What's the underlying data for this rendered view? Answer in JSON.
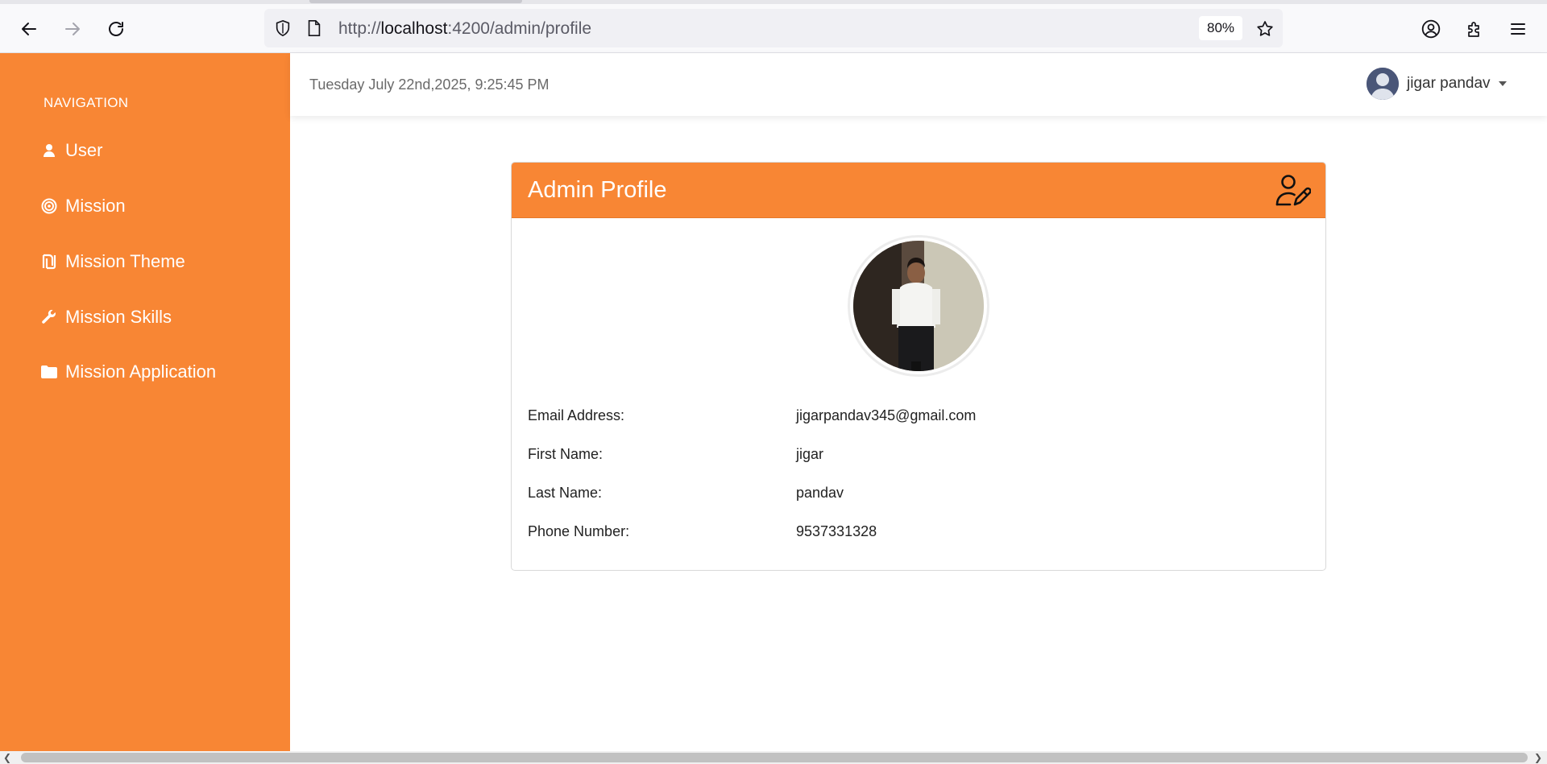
{
  "browser": {
    "url_prefix": "http://",
    "url_host": "localhost",
    "url_rest": ":4200/admin/profile",
    "zoom": "80%"
  },
  "sidebar": {
    "heading": "NAVIGATION",
    "items": [
      {
        "label": "User",
        "icon": "user-icon"
      },
      {
        "label": "Mission",
        "icon": "target-icon"
      },
      {
        "label": "Mission Theme",
        "icon": "theme-icon"
      },
      {
        "label": "Mission Skills",
        "icon": "wrench-icon"
      },
      {
        "label": "Mission Application",
        "icon": "folder-icon"
      }
    ]
  },
  "header": {
    "datetime": "Tuesday July 22nd,2025, 9:25:45 PM",
    "username": "jigar pandav"
  },
  "profile": {
    "title": "Admin Profile",
    "fields": [
      {
        "label": "Email Address:",
        "value": "jigarpandav345@gmail.com"
      },
      {
        "label": "First Name:",
        "value": "jigar"
      },
      {
        "label": "Last Name:",
        "value": "pandav"
      },
      {
        "label": "Phone Number:",
        "value": "9537331328"
      }
    ]
  },
  "colors": {
    "accent": "#f88634",
    "sidebar_text": "#ffffff"
  }
}
